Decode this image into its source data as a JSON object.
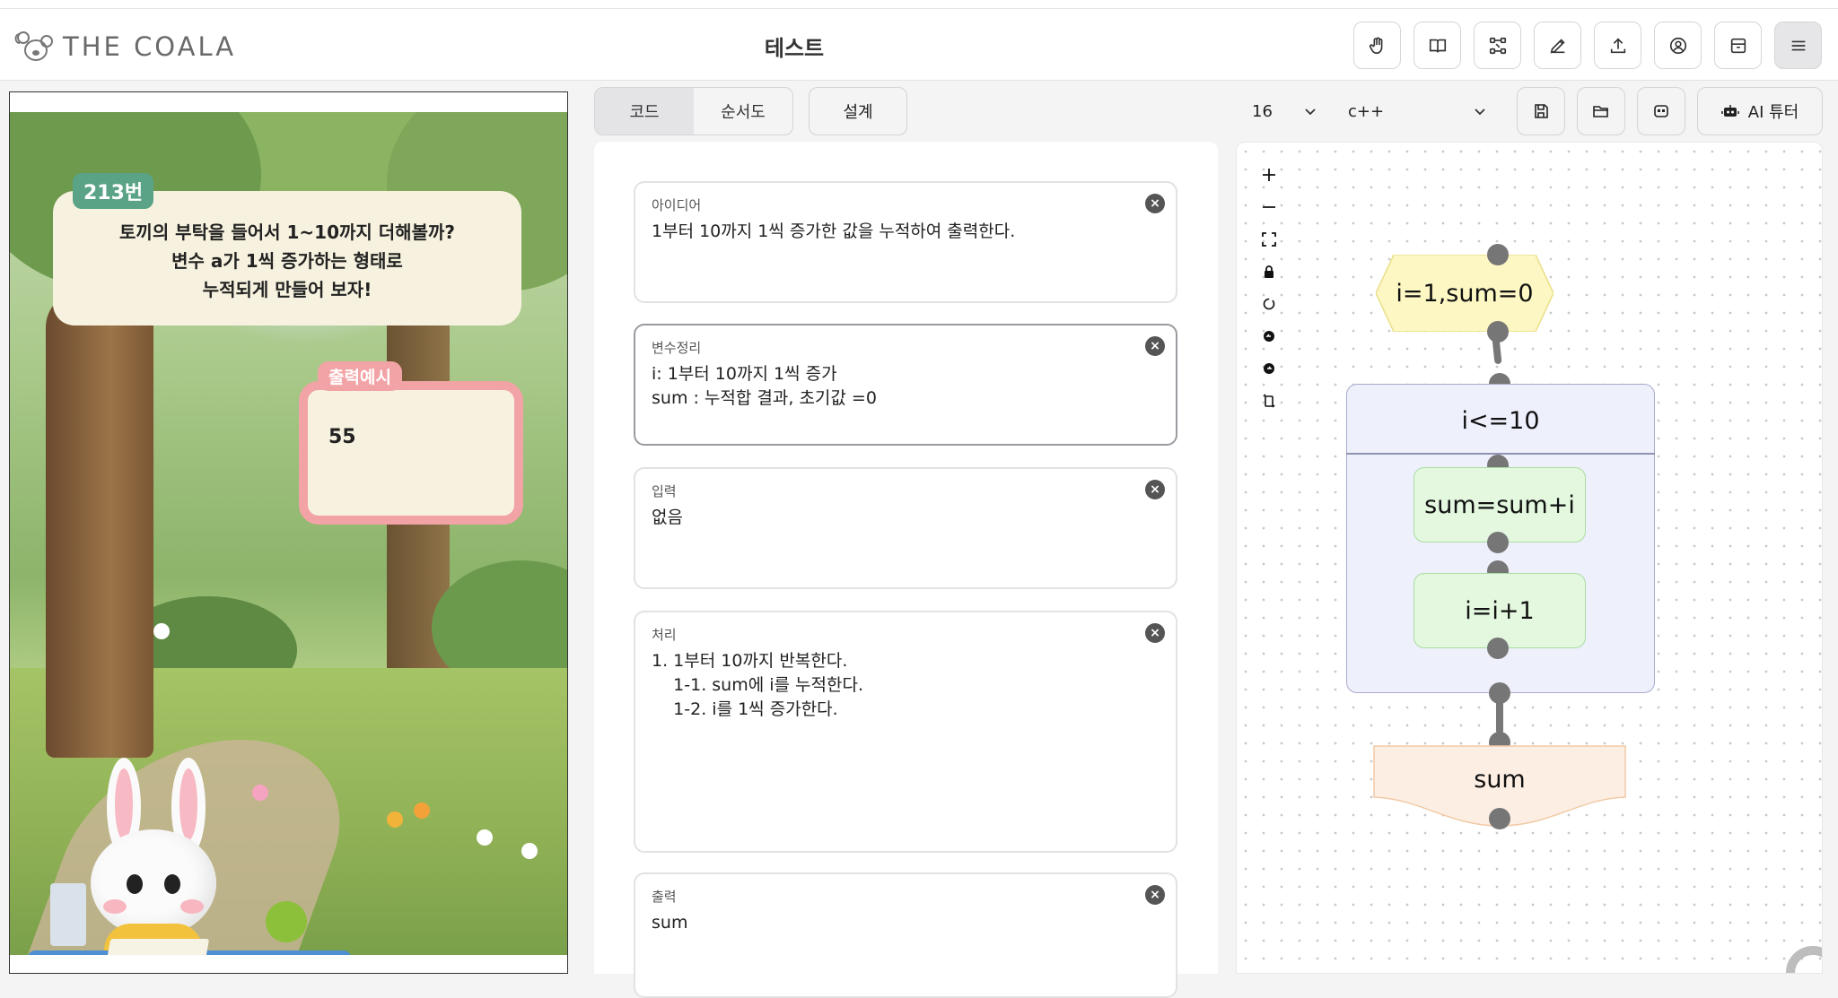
{
  "header": {
    "logo_text": "THE COALA",
    "title": "테스트",
    "buttons": [
      "hand-icon",
      "book-icon",
      "nodes-icon",
      "pencil-icon",
      "upload-icon",
      "user-circle-icon",
      "archive-icon",
      "menu-icon"
    ]
  },
  "problem": {
    "number": "213번",
    "line1": "토끼의 부탁을 들어서 1~10까지 더해볼까?",
    "line2": "변수 a가 1씩 증가하는 형태로",
    "line3": "누적되게 만들어 보자!",
    "output_tag": "출력예시",
    "output_value": "55"
  },
  "tabs": {
    "code": "코드",
    "flowchart": "순서도",
    "design": "설계",
    "active": "code"
  },
  "design_fields": [
    {
      "label": "아이디어",
      "value": "1부터 10까지 1씩 증가한 값을 누적하여 출력한다."
    },
    {
      "label": "변수정리",
      "value": "i: 1부터 10까지 1씩 증가\nsum : 누적합 결과, 초기값 =0"
    },
    {
      "label": "입력",
      "value": "없음"
    },
    {
      "label": "처리",
      "value": "1. 1부터 10까지 반복한다.\n    1-1. sum에 i를 누적한다.\n    1-2. i를 1씩 증가한다."
    },
    {
      "label": "출력",
      "value": "sum"
    }
  ],
  "toolbar": {
    "font_size": "16",
    "language": "c++",
    "ai_tutor": "AI 튜터"
  },
  "canvas_controls": [
    "plus-icon",
    "minus-icon",
    "fit-view-icon",
    "lock-icon",
    "reset-icon",
    "undo-icon",
    "redo-icon",
    "rotate-icon"
  ],
  "flowchart": {
    "init": "i=1,sum=0",
    "loop_condition": "i<=10",
    "step1": "sum=sum+i",
    "step2": "i=i+1",
    "output": "sum"
  },
  "colors": {
    "init_fill": "#fdf7c3",
    "loop_fill": "#eef0fb",
    "process_fill": "#e3f8df",
    "output_fill": "#fdeee3",
    "badge": "#5aa387",
    "output_border": "#f2a3a6"
  }
}
